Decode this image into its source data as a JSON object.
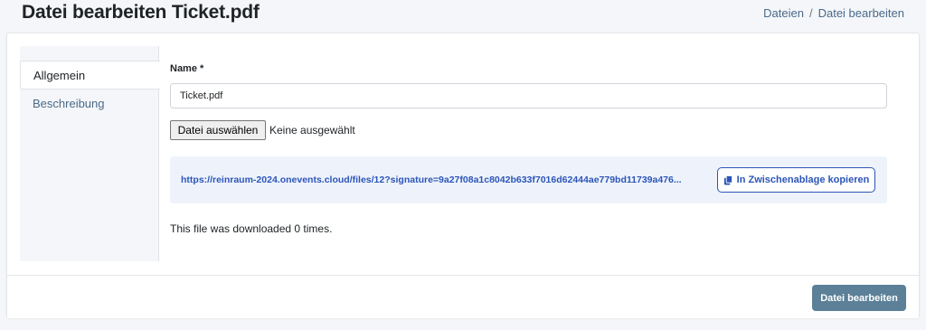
{
  "header": {
    "title": "Datei bearbeiten Ticket.pdf",
    "breadcrumb": {
      "items": [
        "Dateien",
        "Datei bearbeiten"
      ],
      "separator": "/"
    }
  },
  "tabs": [
    {
      "label": "Allgemein",
      "active": true
    },
    {
      "label": "Beschreibung",
      "active": false
    }
  ],
  "form": {
    "name_label": "Name *",
    "name_value": "Ticket.pdf",
    "file_button_label": "Datei auswählen",
    "file_status": "Keine ausgewählt",
    "url": "https://reinraum-2024.onevents.cloud/files/12?signature=9a27f08a1c8042b633f7016d62444ae779bd11739a476...",
    "copy_button_label": "In Zwischenablage kopieren",
    "copy_icon": "copy-icon",
    "download_info": "This file was downloaded 0 times."
  },
  "footer": {
    "submit_label": "Datei bearbeiten"
  },
  "colors": {
    "accent": "#2c55b8",
    "submit_bg": "#5b8097",
    "link": "#4a6a8a",
    "url_box_bg": "#eef3fb"
  }
}
